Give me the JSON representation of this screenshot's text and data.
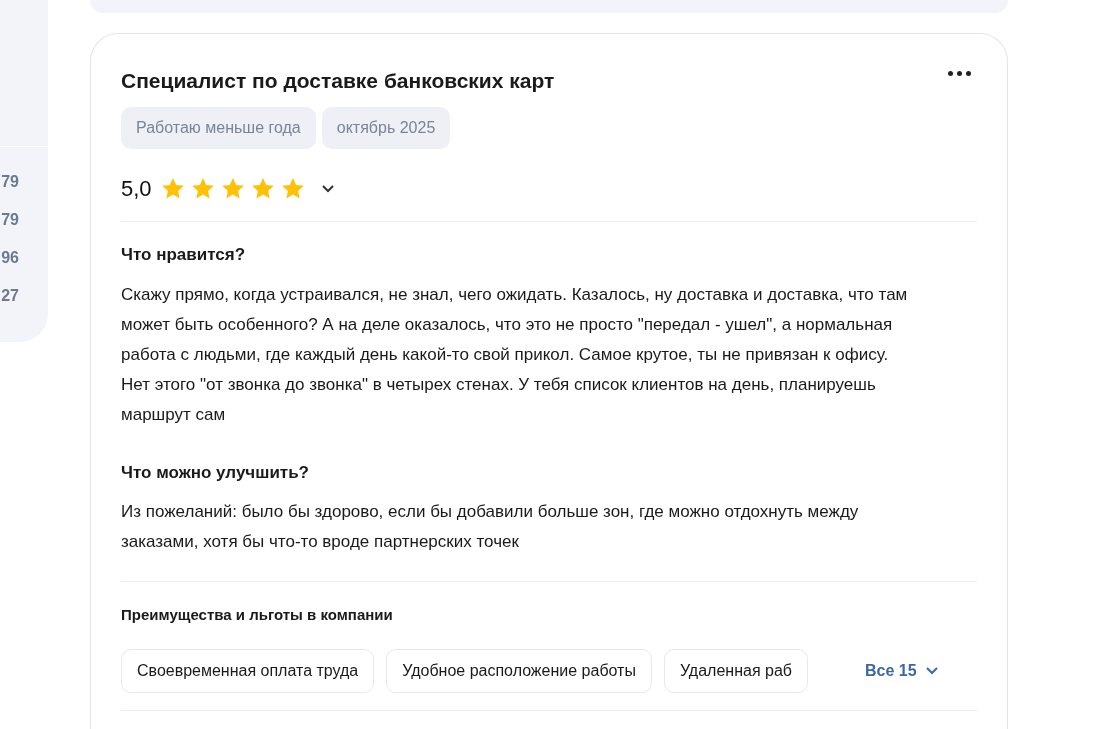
{
  "sidebar": {
    "values": [
      "79",
      "79",
      "96",
      "27"
    ]
  },
  "review": {
    "title": "Специалист по доставке банковских карт",
    "tags": [
      "Работаю меньше года",
      "октябрь 2025"
    ],
    "rating": "5,0",
    "stars": 5,
    "sections": [
      {
        "heading": "Что нравится?",
        "text": "Скажу прямо, когда устраивался, не знал, чего ожидать. Казалось, ну доставка и доставка, что там может быть особенного? А на деле оказалось, что это не просто \"передал - ушел\", а нормальная работа с людьми, где каждый день какой-то свой прикол. Самое крутое, ты не привязан к офису. Нет этого \"от звонка до звонка\" в четырех стенах. У тебя список клиентов на день, планируешь маршрут сам"
      },
      {
        "heading": "Что можно улучшить?",
        "text": "Из пожеланий: было бы здорово, если бы добавили больше зон, где можно отдохнуть между заказами, хотя бы что-то вроде партнерских точек"
      }
    ],
    "benefits": {
      "heading": "Преимущества и льготы в компании",
      "items": [
        "Своевременная оплата труда",
        "Удобное расположение работы",
        "Удаленная раб"
      ],
      "more": "Все 15"
    }
  }
}
